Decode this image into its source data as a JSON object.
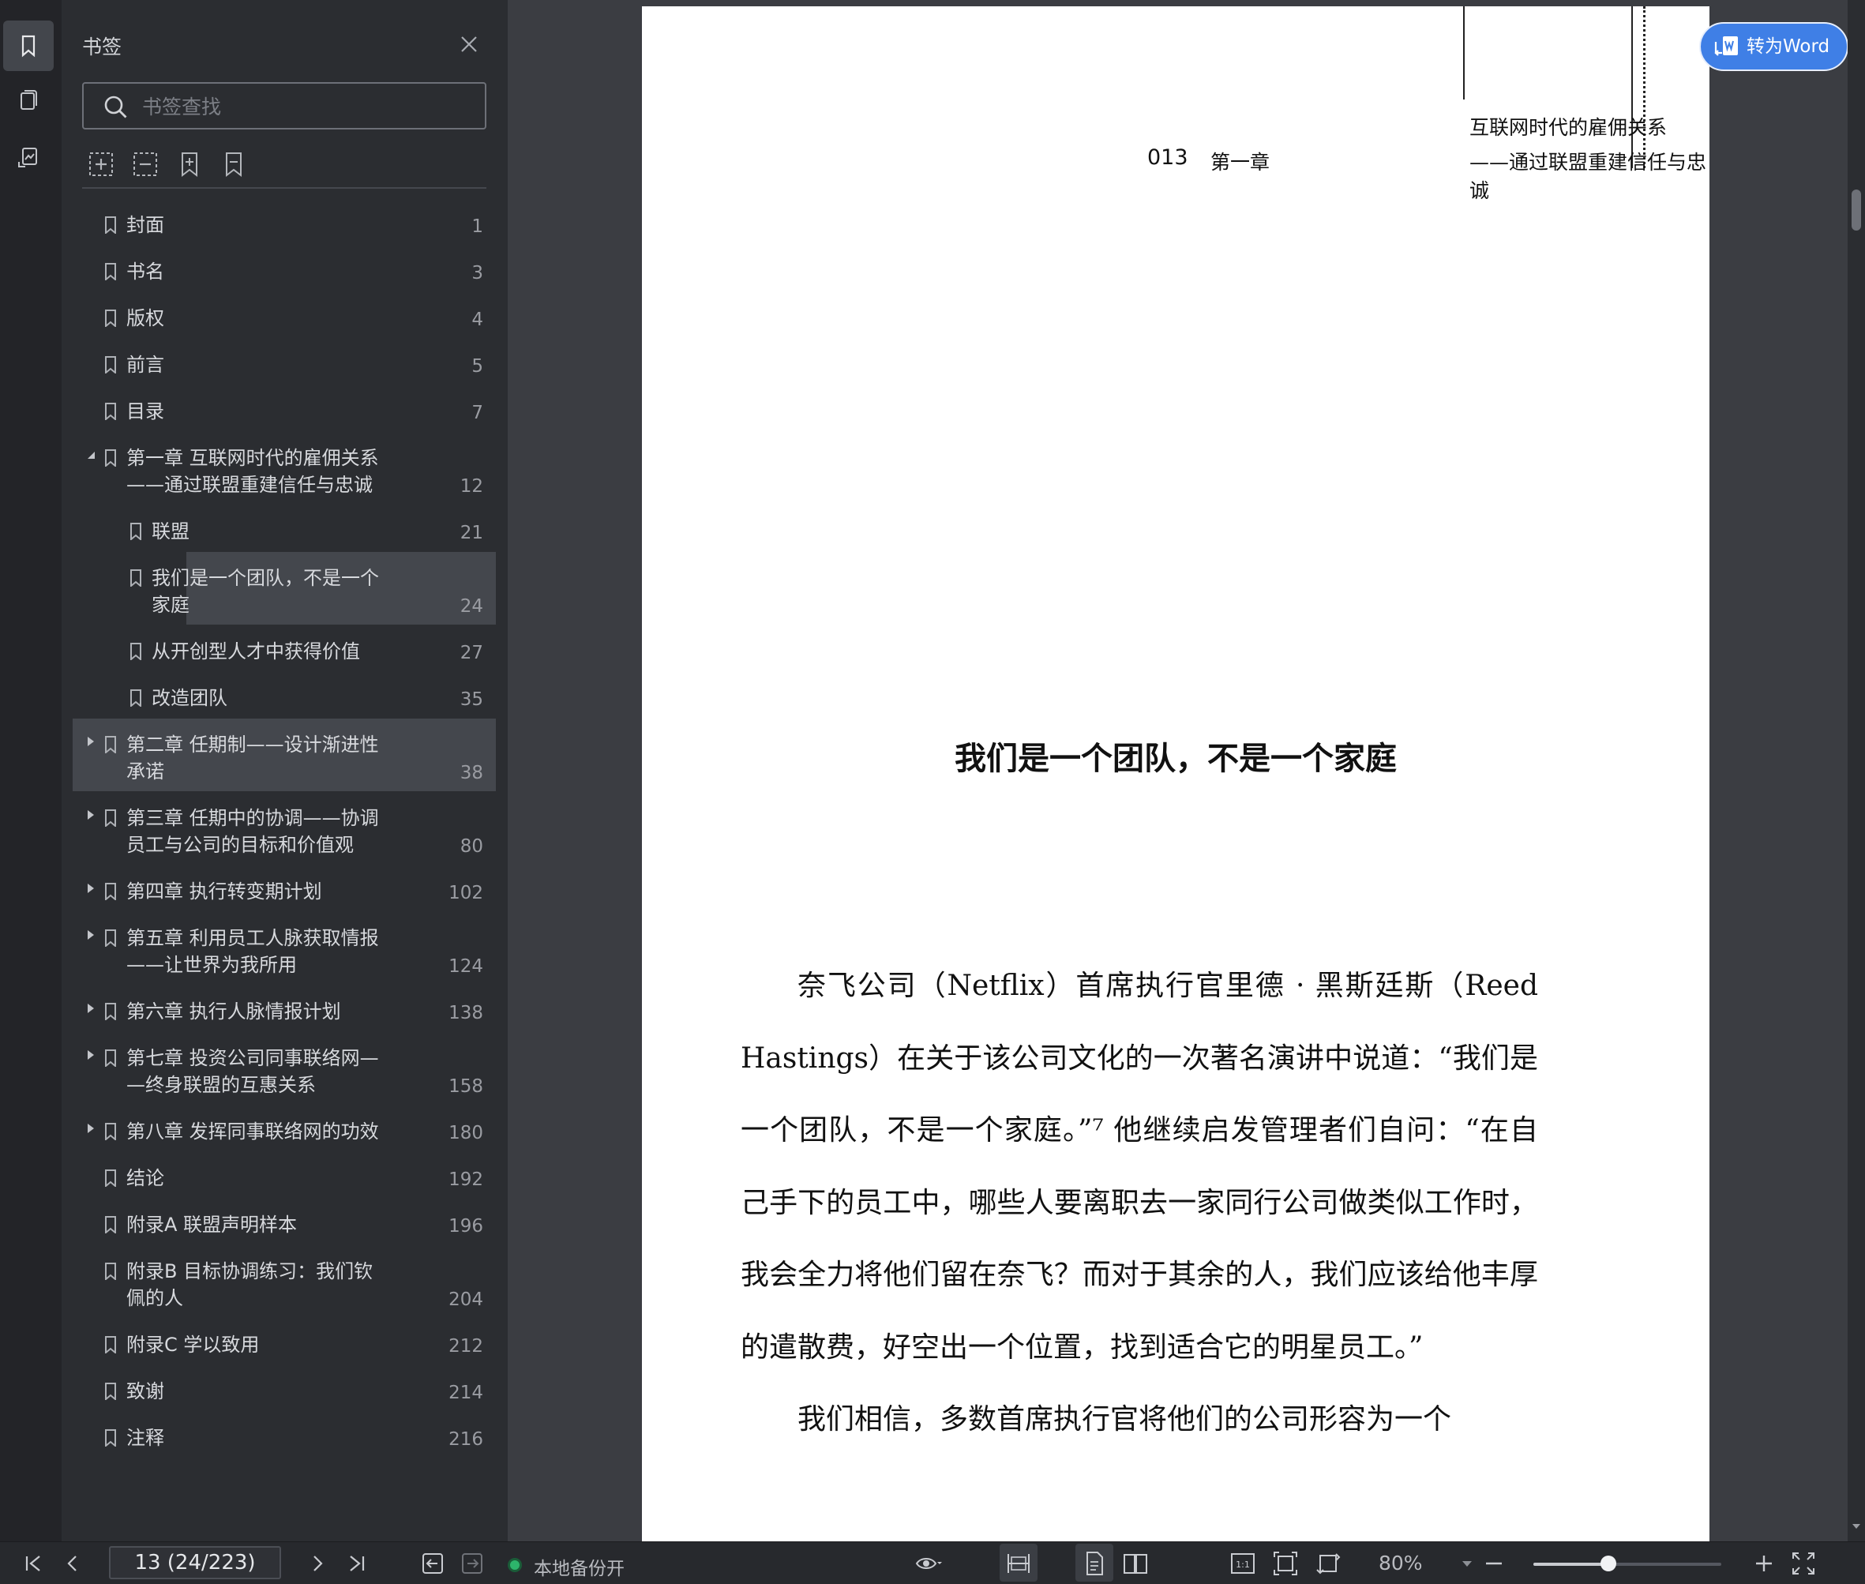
{
  "panel": {
    "title": "书签",
    "search_placeholder": "书签查找"
  },
  "toc": [
    {
      "label": "封面",
      "page": "1",
      "level": 0,
      "expander": "none"
    },
    {
      "label": "书名",
      "page": "3",
      "level": 0,
      "expander": "none"
    },
    {
      "label": "版权",
      "page": "4",
      "level": 0,
      "expander": "none"
    },
    {
      "label": "前言",
      "page": "5",
      "level": 0,
      "expander": "none"
    },
    {
      "label": "目录",
      "page": "7",
      "level": 0,
      "expander": "none"
    },
    {
      "label": "第一章 互联网时代的雇佣关系\n——通过联盟重建信任与忠诚",
      "page": "12",
      "level": 0,
      "expander": "expanded"
    },
    {
      "label": "联盟",
      "page": "21",
      "level": 1,
      "expander": "none"
    },
    {
      "label": "我们是一个团队，不是一个\n家庭",
      "page": "24",
      "level": 1,
      "expander": "none",
      "selected": true
    },
    {
      "label": "从开创型人才中获得价值",
      "page": "27",
      "level": 1,
      "expander": "none"
    },
    {
      "label": "改造团队",
      "page": "35",
      "level": 1,
      "expander": "none"
    },
    {
      "label": "第二章 任期制——设计渐进性\n承诺",
      "page": "38",
      "level": 0,
      "expander": "collapsed",
      "hovered": true
    },
    {
      "label": "第三章 任期中的协调——协调\n员工与公司的目标和价值观",
      "page": "80",
      "level": 0,
      "expander": "collapsed"
    },
    {
      "label": "第四章 执行转变期计划",
      "page": "102",
      "level": 0,
      "expander": "collapsed"
    },
    {
      "label": "第五章 利用员工人脉获取情报\n——让世界为我所用",
      "page": "124",
      "level": 0,
      "expander": "collapsed"
    },
    {
      "label": "第六章 执行人脉情报计划",
      "page": "138",
      "level": 0,
      "expander": "collapsed"
    },
    {
      "label": "第七章 投资公司同事联络网—\n—终身联盟的互惠关系",
      "page": "158",
      "level": 0,
      "expander": "collapsed"
    },
    {
      "label": "第八章 发挥同事联络网的功效",
      "page": "180",
      "level": 0,
      "expander": "collapsed"
    },
    {
      "label": "结论",
      "page": "192",
      "level": 0,
      "expander": "none"
    },
    {
      "label": "附录A 联盟声明样本",
      "page": "196",
      "level": 0,
      "expander": "none"
    },
    {
      "label": "附录B 目标协调练习：我们钦\n佩的人",
      "page": "204",
      "level": 0,
      "expander": "none"
    },
    {
      "label": "附录C 学以致用",
      "page": "212",
      "level": 0,
      "expander": "none"
    },
    {
      "label": "致谢",
      "page": "214",
      "level": 0,
      "expander": "none"
    },
    {
      "label": "注释",
      "page": "216",
      "level": 0,
      "expander": "none"
    }
  ],
  "document": {
    "running_title_top": "互联网时代的雇佣关系",
    "page_number": "013",
    "chapter_label": "第一章",
    "running_title_sub": "——通过联盟重建信任与忠诚",
    "section_title": "我们是一个团队，不是一个家庭",
    "paragraphs": [
      "奈飞公司（Netflix）首席执行官里德 · 黑斯廷斯（Reed Hastings）在关于该公司文化的一次著名演讲中说道：“我们是一个团队，不是一个家庭。”⁷ 他继续启发管理者们自问：“在自己手下的员工中，哪些人要离职去一家同行公司做类似工作时，我会全力将他们留在奈飞？而对于其余的人，我们应该给他丰厚的遣散费，好空出一个位置，找到适合它的明星员工。”",
      "我们相信，多数首席执行官将他们的公司形容为一个"
    ]
  },
  "convert_button": {
    "label": "转为Word"
  },
  "statusbar": {
    "page_field": "13 (24/223)",
    "backup_status": "本地备份开",
    "zoom": "80%",
    "zoom_slider_fraction": 0.4
  },
  "colors": {
    "accent": "#3f7fe6",
    "backup_on": "#2db46b",
    "selected_row": "#44474d"
  }
}
